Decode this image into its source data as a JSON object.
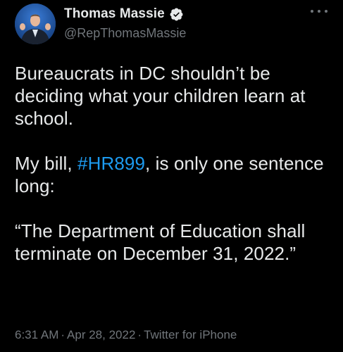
{
  "author": {
    "display_name": "Thomas Massie",
    "handle": "@RepThomasMassie",
    "verified_icon": "verified-badge-icon",
    "avatar_icon": "profile-photo"
  },
  "menu": {
    "more_icon": "more-horizontal-icon"
  },
  "tweet": {
    "para1": "Bureaucrats in DC shouldn’t be deciding what your children learn at school.",
    "para2_prefix": "My bill, ",
    "hashtag": "#HR899",
    "para2_suffix": ", is only one sentence long:",
    "para3": "“The Department of Education shall terminate on December 31, 2022.”"
  },
  "meta": {
    "time": "6:31 AM",
    "date": "Apr 28, 2022",
    "source": "Twitter for iPhone",
    "separator": "·"
  },
  "colors": {
    "background": "#000000",
    "text": "#e7e9ea",
    "muted": "#71767b",
    "link": "#1d9bf0"
  }
}
